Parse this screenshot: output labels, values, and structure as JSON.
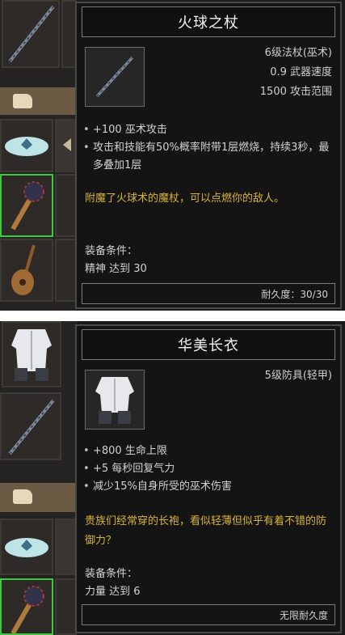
{
  "tooltips": [
    {
      "title": "火球之杖",
      "type": "6级法杖(巫术)",
      "info": [
        "0.9 武器速度",
        "1500 攻击范围"
      ],
      "stats": [
        "+100 巫术攻击",
        "攻击和技能有50%概率附带1层燃烧，持续3秒，最多叠加1层"
      ],
      "lore": "附魔了火球术的魔杖，可以点燃你的敌人。",
      "req_label": "装备条件：",
      "req_value": "精神 达到 30",
      "durability": "耐久度：30/30"
    },
    {
      "title": "华美长衣",
      "type": "5级防具(轻甲)",
      "info": [],
      "stats": [
        "+800 生命上限",
        "+5 每秒回复气力",
        "减少15%自身所受的巫术伤害"
      ],
      "lore": "贵族们经常穿的长袍，看似轻薄但似乎有着不错的防御力？",
      "req_label": "装备条件：",
      "req_value": "力量 达到 6",
      "durability": "无限耐久度"
    }
  ],
  "colors": {
    "lore": "#d8b431",
    "selected_border": "#3ec83e"
  }
}
